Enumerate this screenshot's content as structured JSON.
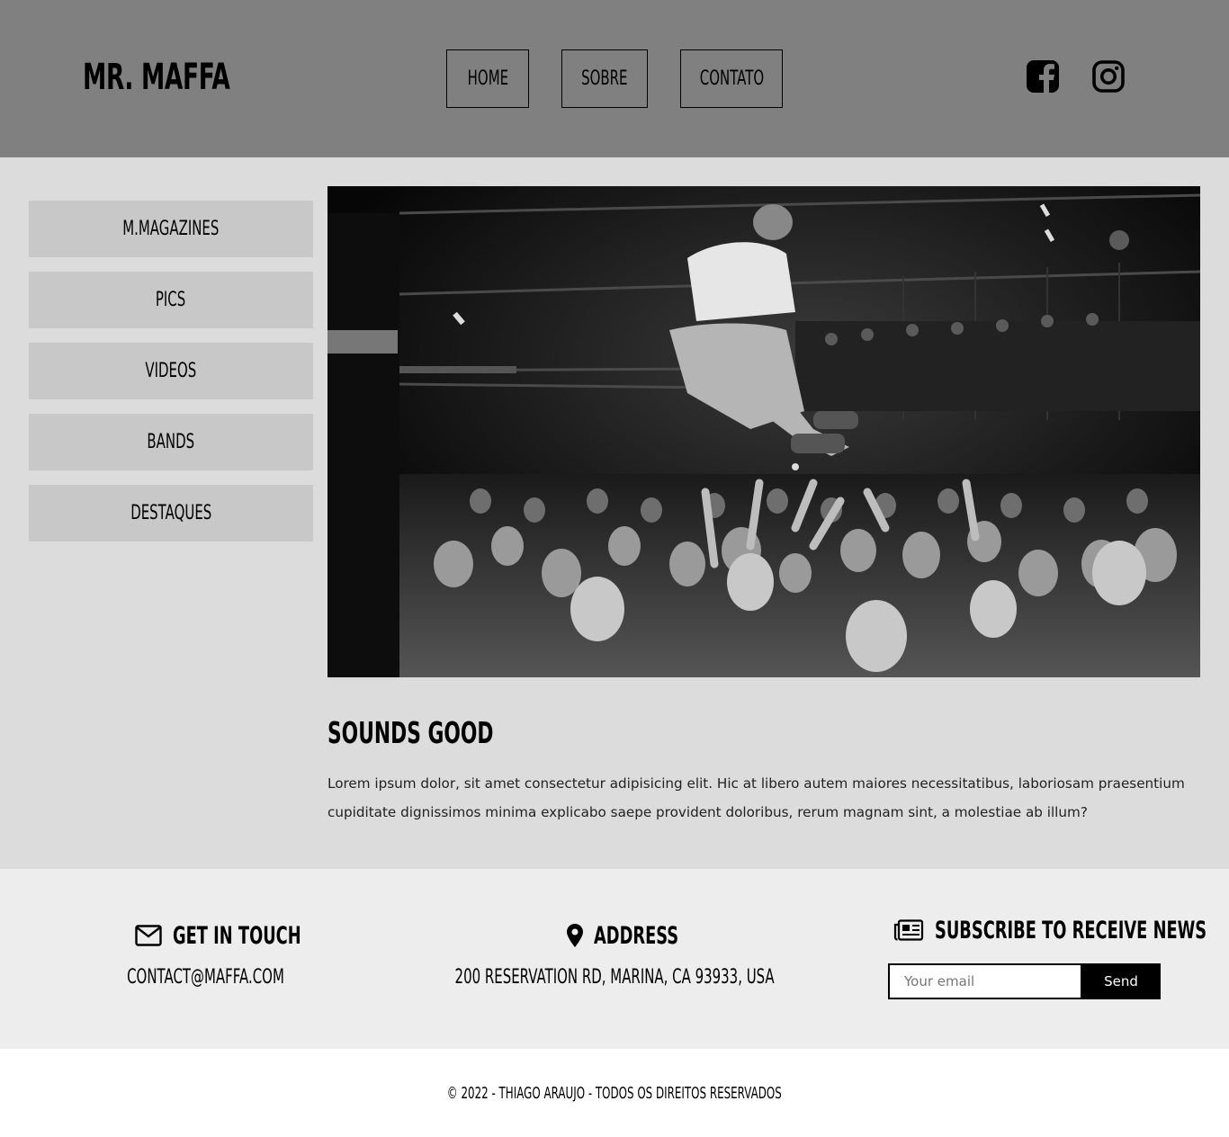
{
  "header": {
    "logo": "MR. MAFFA",
    "nav": [
      {
        "label": "HOME"
      },
      {
        "label": "SOBRE"
      },
      {
        "label": "CONTATO"
      }
    ],
    "social": [
      {
        "icon": "facebook-icon"
      },
      {
        "icon": "instagram-icon"
      }
    ]
  },
  "sidebar": {
    "items": [
      {
        "label": "M.MAGAZINES"
      },
      {
        "label": "PICS"
      },
      {
        "label": "VIDEOS"
      },
      {
        "label": "BANDS"
      },
      {
        "label": "DESTAQUES"
      }
    ]
  },
  "post": {
    "image": "concert-stage-dive-photo",
    "title": "SOUNDS GOOD",
    "body": "Lorem ipsum dolor, sit amet consectetur adipisicing elit. Hic at libero autem maiores necessitatibus, laboriosam praesentium cupiditate dignissimos minima explicabo saepe provident doloribus, rerum magnam sint, a molestiae ab illum?"
  },
  "footer": {
    "contact": {
      "icon": "envelope-icon",
      "title": "GET IN TOUCH",
      "text": "CONTACT@MAFFA.COM"
    },
    "address": {
      "icon": "map-pin-icon",
      "title": "ADDRESS",
      "text": "200 RESERVATION RD, MARINA, CA 93933, USA"
    },
    "subscribe": {
      "icon": "newspaper-icon",
      "title": "SUBSCRIBE TO RECEIVE NEWS",
      "placeholder": "Your email",
      "button": "Send"
    },
    "copyright": "© 2022 - THIAGO ARAUJO - TODOS OS DIREITOS RESERVADOS"
  },
  "colors": {
    "header_bg": "#808080",
    "main_bg": "#dcdcdc",
    "sidebar_btn_bg": "#c8c8c8",
    "info_bg": "#ededed",
    "button_bg": "#000000"
  }
}
